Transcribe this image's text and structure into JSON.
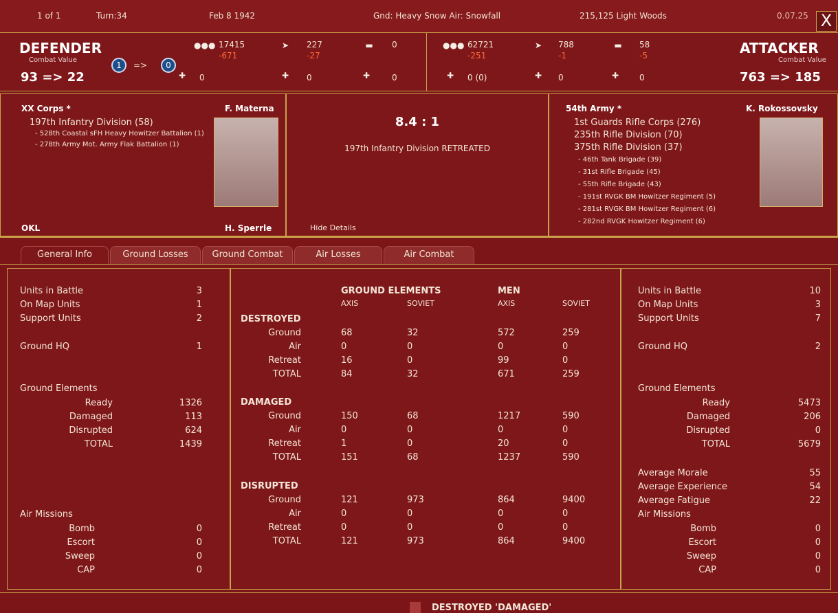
{
  "topbar": {
    "page": "1 of 1",
    "turn": "Turn:34",
    "date": "Feb 8 1942",
    "weather": "Gnd: Heavy Snow  Air: Snowfall",
    "location": "215,125  Light Woods",
    "version": "0.07.25",
    "close": "X"
  },
  "defender": {
    "label": "DEFENDER",
    "cv_label": "Combat Value",
    "cv": "93  =>  22",
    "circle_from": "1",
    "arrow": "=>",
    "circle_to": "0",
    "men": "17415",
    "men_loss": "-671",
    "planes": "227",
    "planes_loss": "-27",
    "tanks": "0",
    "air1": "0",
    "air2": "0",
    "air3": "0"
  },
  "attacker": {
    "label": "ATTACKER",
    "cv_label": "Combat Value",
    "cv": "763  =>  185",
    "men": "62721",
    "men_loss": "-251",
    "planes": "788",
    "planes_loss": "-1",
    "tanks": "58",
    "tanks_loss": "-5",
    "air1": "0 (0)",
    "air2": "0",
    "air3": "0"
  },
  "left_info": {
    "corps": "XX Corps *",
    "commander": "F. Materna",
    "lines": [
      "197th Infantry Division (58)",
      "- 528th Coastal sFH Heavy Howitzer Battalion (1)",
      "- 278th Army Mot. Army Flak Battalion (1)"
    ],
    "bottom_left": "OKL",
    "bottom_right": "H. Sperrle"
  },
  "center_info": {
    "odds": "8.4 : 1",
    "result": "197th Infantry Division RETREATED",
    "hide": "Hide Details"
  },
  "right_info": {
    "army": "54th Army *",
    "commander": "K. Rokossovsky",
    "lines": [
      "1st Guards Rifle Corps (276)",
      "235th Rifle Division (70)",
      "375th Rifle Division (37)",
      "- 46th Tank Brigade (39)",
      "- 31st Rifle Brigade (45)",
      "- 55th Rifle Brigade (43)",
      "- 191st RVGK BM Howitzer Regiment (5)",
      "- 281st RVGK BM Howitzer Regiment (6)",
      "- 282nd RVGK Howitzer Regiment (6)"
    ]
  },
  "tabs": [
    "General Info",
    "Ground Losses",
    "Ground Combat",
    "Air Losses",
    "Air Combat"
  ],
  "left_stats": [
    {
      "label": "Units in Battle",
      "value": "3"
    },
    {
      "label": "On Map Units",
      "value": "1"
    },
    {
      "label": "Support Units",
      "value": "2"
    },
    {
      "label": "Ground HQ",
      "value": "1"
    },
    {
      "label": "Ground Elements",
      "value": ""
    },
    {
      "label": "Ready",
      "value": "1326"
    },
    {
      "label": "Damaged",
      "value": "113"
    },
    {
      "label": "Disrupted",
      "value": "624"
    },
    {
      "label": "TOTAL",
      "value": "1439"
    },
    {
      "label": "Air Missions",
      "value": ""
    },
    {
      "label": "Bomb",
      "value": "0"
    },
    {
      "label": "Escort",
      "value": "0"
    },
    {
      "label": "Sweep",
      "value": "0"
    },
    {
      "label": "CAP",
      "value": "0"
    }
  ],
  "right_stats": [
    {
      "label": "Units in Battle",
      "value": "10"
    },
    {
      "label": "On Map Units",
      "value": "3"
    },
    {
      "label": "Support Units",
      "value": "7"
    },
    {
      "label": "Ground HQ",
      "value": "2"
    },
    {
      "label": "Ground Elements",
      "value": ""
    },
    {
      "label": "Ready",
      "value": "5473"
    },
    {
      "label": "Damaged",
      "value": "206"
    },
    {
      "label": "Disrupted",
      "value": "0"
    },
    {
      "label": "TOTAL",
      "value": "5679"
    },
    {
      "label": "Average Morale",
      "value": "55"
    },
    {
      "label": "Average Experience",
      "value": "54"
    },
    {
      "label": "Average Fatigue",
      "value": "22"
    },
    {
      "label": "Air Missions",
      "value": ""
    },
    {
      "label": "Bomb",
      "value": "0"
    },
    {
      "label": "Escort",
      "value": "0"
    },
    {
      "label": "Sweep",
      "value": "0"
    },
    {
      "label": "CAP",
      "value": "0"
    }
  ],
  "center_table": {
    "h_ground": "GROUND ELEMENTS",
    "h_men": "MEN",
    "sub": [
      "AXIS",
      "SOVIET",
      "AXIS",
      "SOVIET"
    ],
    "sections": [
      {
        "title": "DESTROYED",
        "rows": [
          [
            "Ground",
            "68",
            "32",
            "572",
            "259"
          ],
          [
            "Air",
            "0",
            "0",
            "0",
            "0"
          ],
          [
            "Retreat",
            "16",
            "0",
            "99",
            "0"
          ],
          [
            "TOTAL",
            "84",
            "32",
            "671",
            "259"
          ]
        ]
      },
      {
        "title": "DAMAGED",
        "rows": [
          [
            "Ground",
            "150",
            "68",
            "1217",
            "590"
          ],
          [
            "Air",
            "0",
            "0",
            "0",
            "0"
          ],
          [
            "Retreat",
            "1",
            "0",
            "20",
            "0"
          ],
          [
            "TOTAL",
            "151",
            "68",
            "1237",
            "590"
          ]
        ]
      },
      {
        "title": "DISRUPTED",
        "rows": [
          [
            "Ground",
            "121",
            "973",
            "864",
            "9400"
          ],
          [
            "Air",
            "0",
            "0",
            "0",
            "0"
          ],
          [
            "Retreat",
            "0",
            "0",
            "0",
            "0"
          ],
          [
            "TOTAL",
            "121",
            "973",
            "864",
            "9400"
          ]
        ]
      }
    ]
  },
  "footer": {
    "legend": "DESTROYED 'DAMAGED'"
  }
}
